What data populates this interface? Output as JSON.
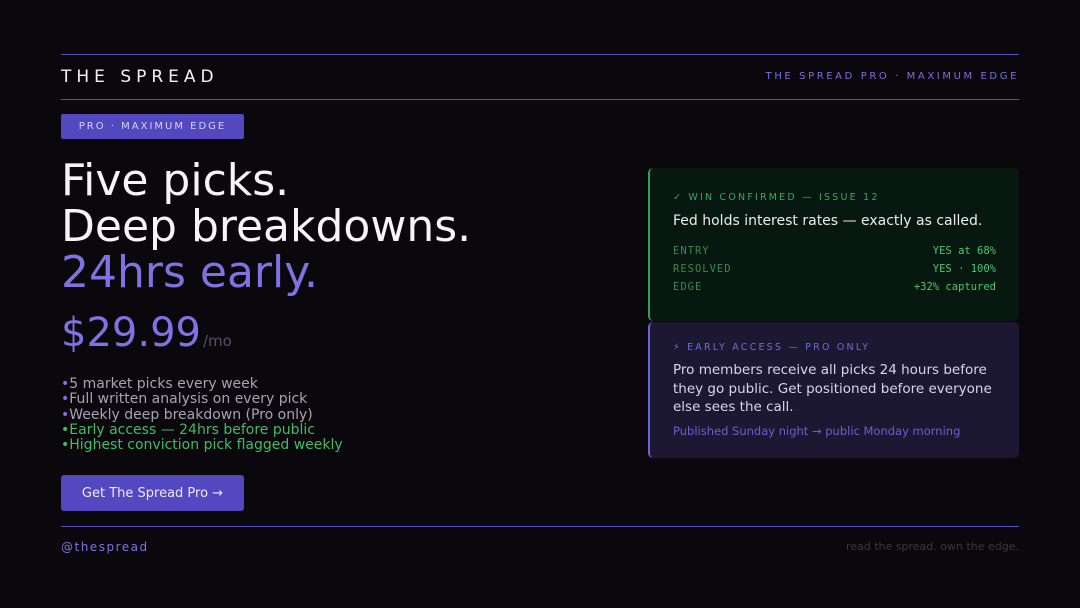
{
  "header": {
    "brand": "THE SPREAD",
    "tag": "THE SPREAD PRO · MAXIMUM EDGE"
  },
  "badge": "PRO · MAXIMUM EDGE",
  "headline": {
    "line1": "Five picks.",
    "line2": "Deep breakdowns.",
    "line3": "24hrs early."
  },
  "price": {
    "amount": "$29.99",
    "period": "/mo"
  },
  "features": [
    {
      "text": "5 market picks every week",
      "highlight": false
    },
    {
      "text": "Full written analysis on every pick",
      "highlight": false
    },
    {
      "text": "Weekly deep breakdown (Pro only)",
      "highlight": false
    },
    {
      "text": "Early access — 24hrs before public",
      "highlight": true
    },
    {
      "text": "Highest conviction pick flagged weekly",
      "highlight": true
    }
  ],
  "feature_bullet": "•",
  "cta": "Get The Spread Pro →",
  "win_card": {
    "label": "✓ WIN CONFIRMED — ISSUE 12",
    "title": "Fed holds interest rates — exactly as called.",
    "stats": [
      {
        "key": "ENTRY",
        "value": "YES at 68%"
      },
      {
        "key": "RESOLVED",
        "value": "YES · 100%"
      },
      {
        "key": "EDGE",
        "value": "+32% captured"
      }
    ]
  },
  "early_card": {
    "label": "⚡ EARLY ACCESS — PRO ONLY",
    "body": "Pro members receive all picks 24 hours before they go public. Get positioned before everyone else sees the call.",
    "footer": "Published Sunday night → public Monday morning"
  },
  "footer": {
    "handle": "@thespread",
    "tagline": "read the spread. own the edge."
  },
  "colors": {
    "accent": "#7f72e2",
    "button": "#5448c0",
    "success": "#3ebd63",
    "background": "#0b080d"
  }
}
